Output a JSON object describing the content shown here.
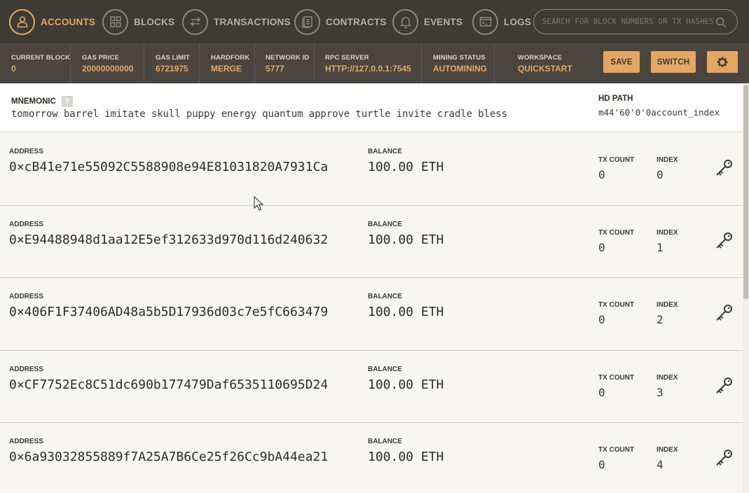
{
  "nav": {
    "items": [
      {
        "label": "ACCOUNTS",
        "icon": "accounts-icon",
        "active": true
      },
      {
        "label": "BLOCKS",
        "icon": "blocks-icon",
        "active": false
      },
      {
        "label": "TRANSACTIONS",
        "icon": "transactions-icon",
        "active": false
      },
      {
        "label": "CONTRACTS",
        "icon": "contracts-icon",
        "active": false
      },
      {
        "label": "EVENTS",
        "icon": "bell-icon",
        "active": false
      },
      {
        "label": "LOGS",
        "icon": "terminal-icon",
        "active": false
      }
    ],
    "search_placeholder": "SEARCH FOR BLOCK NUMBERS OR TX HASHES"
  },
  "status": {
    "current_block": {
      "label": "CURRENT BLOCK",
      "value": "0"
    },
    "gas_price": {
      "label": "GAS PRICE",
      "value": "20000000000"
    },
    "gas_limit": {
      "label": "GAS LIMIT",
      "value": "6721975"
    },
    "hardfork": {
      "label": "HARDFORK",
      "value": "MERGE"
    },
    "network_id": {
      "label": "NETWORK ID",
      "value": "5777"
    },
    "rpc_server": {
      "label": "RPC SERVER",
      "value": "HTTP://127.0.0.1:7545"
    },
    "mining_status": {
      "label": "MINING STATUS",
      "value": "AUTOMINING"
    },
    "workspace": {
      "label": "WORKSPACE",
      "value": "QUICKSTART"
    },
    "save_label": "SAVE",
    "switch_label": "SWITCH"
  },
  "mnemonic": {
    "title": "MNEMONIC",
    "help": "?",
    "words": "tomorrow barrel imitate skull puppy energy quantum approve turtle invite cradle bless",
    "hd_path_title": "HD PATH",
    "hd_path_value": "m44'60'0'0account_index"
  },
  "labels": {
    "address": "ADDRESS",
    "balance": "BALANCE",
    "tx_count": "TX COUNT",
    "index": "INDEX"
  },
  "accounts": [
    {
      "address": "0×cB41e71e55092C5588908e94E81031820A7931Ca",
      "balance": "100.00 ETH",
      "tx_count": "0",
      "index": "0"
    },
    {
      "address": "0×E94488948d1aa12E5ef312633d970d116d240632",
      "balance": "100.00 ETH",
      "tx_count": "0",
      "index": "1"
    },
    {
      "address": "0×406F1F37406AD48a5b5D17936d03c7e5fC663479",
      "balance": "100.00 ETH",
      "tx_count": "0",
      "index": "2"
    },
    {
      "address": "0×CF7752Ec8C51dc690b177479Daf6535110695D24",
      "balance": "100.00 ETH",
      "tx_count": "0",
      "index": "3"
    },
    {
      "address": "0×6a93032855889f7A25A7B6Ce25f26Cc9bA44ea21",
      "balance": "100.00 ETH",
      "tx_count": "0",
      "index": "4"
    }
  ],
  "colors": {
    "accent": "#e4a663",
    "nav_bg": "#3e3b35",
    "status_bg": "#4a463f"
  }
}
